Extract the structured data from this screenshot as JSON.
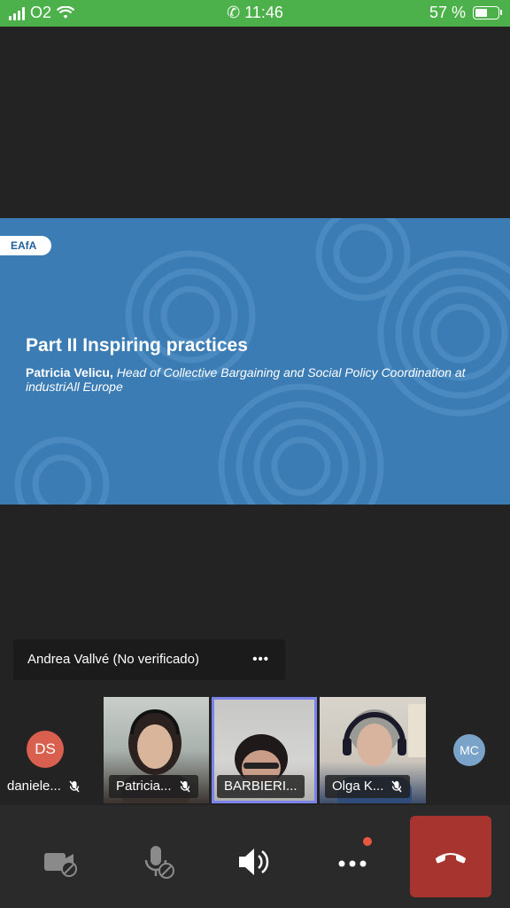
{
  "status_bar": {
    "carrier": "O2",
    "time": "11:46",
    "battery": "57 %",
    "battery_level": 0.57
  },
  "slide": {
    "logo": "EAfA",
    "title": "Part II Inspiring practices",
    "presenter_name": "Patricia Velicu,",
    "presenter_role": "Head of Collective Bargaining and Social Policy Coordination at industriAll Europe",
    "background_color": "#3b7cb4"
  },
  "active_speaker": {
    "name": "Andrea Vallvé (No verificado)",
    "more_label": "•••"
  },
  "participants": [
    {
      "initials": "DS",
      "name": "daniele...",
      "avatar_color": "#d9604f",
      "muted": true
    },
    {
      "name": "Patricia...",
      "muted": true,
      "video": true
    },
    {
      "name": "BARBIERI...",
      "muted": false,
      "video": true,
      "highlighted": true
    },
    {
      "name": "Olga K...",
      "muted": true,
      "video": true
    },
    {
      "initials": "MC",
      "avatar_color": "#7aa3c9"
    }
  ],
  "controls": {
    "camera": "camera-off",
    "microphone": "mic-off",
    "speaker": "speaker-on",
    "more": "more-options",
    "hangup": "end-call"
  }
}
